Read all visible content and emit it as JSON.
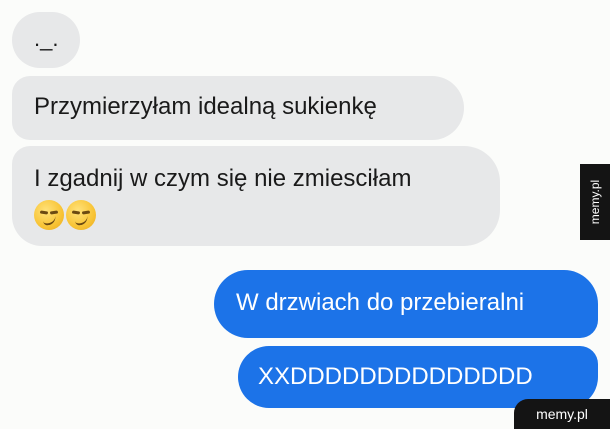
{
  "conversation": {
    "messages": [
      {
        "sender": "other",
        "text": "._."
      },
      {
        "sender": "other",
        "text": "Przymierzyłam idealną sukienkę"
      },
      {
        "sender": "other",
        "text": "I zgadnij w czym się nie zmiesciłam",
        "emojis": [
          "smirking-face",
          "smirking-face"
        ]
      },
      {
        "sender": "me",
        "text": "W drzwiach do przebieralni"
      },
      {
        "sender": "me",
        "text": "XXDDDDDDDDDDDDDD"
      }
    ]
  },
  "watermark": {
    "side": "memy.pl",
    "corner": "memy.pl"
  },
  "colors": {
    "background": "#fbfcfa",
    "incoming_bubble": "#e7e8e9",
    "outgoing_bubble": "#1c73e8",
    "watermark_bg": "#141414"
  }
}
